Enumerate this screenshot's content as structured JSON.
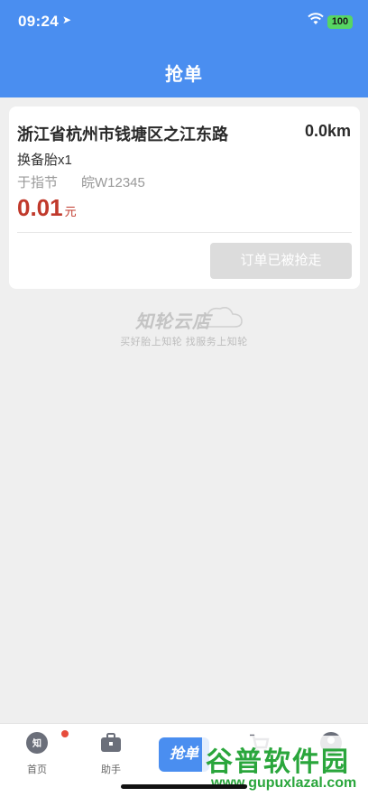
{
  "status_bar": {
    "time": "09:24",
    "battery": "100"
  },
  "header": {
    "title": "抢单"
  },
  "order": {
    "address": "浙江省杭州市钱塘区之江东路",
    "distance": "0.0km",
    "item": "换备胎x1",
    "customer_name": "于指节",
    "plate": "皖W12345",
    "price": "0.01",
    "price_unit": "元",
    "action_label": "订单已被抢走"
  },
  "brand": {
    "name": "知轮云店",
    "slogan": "买好胎上知轮   找服务上知轮"
  },
  "tabs": [
    {
      "label": "首页",
      "icon": "home-icon",
      "badge": true
    },
    {
      "label": "助手",
      "icon": "briefcase-icon"
    },
    {
      "label": "抢单",
      "icon": "grab-order"
    },
    {
      "label": "",
      "icon": "cart-icon"
    },
    {
      "label": "",
      "icon": "user-icon"
    }
  ],
  "watermark": {
    "title": "谷普软件园",
    "url": "www.gupuxlazal.com"
  },
  "colors": {
    "primary": "#4a8ef0",
    "price": "#c0392b",
    "disabled": "#dcdcdc"
  }
}
